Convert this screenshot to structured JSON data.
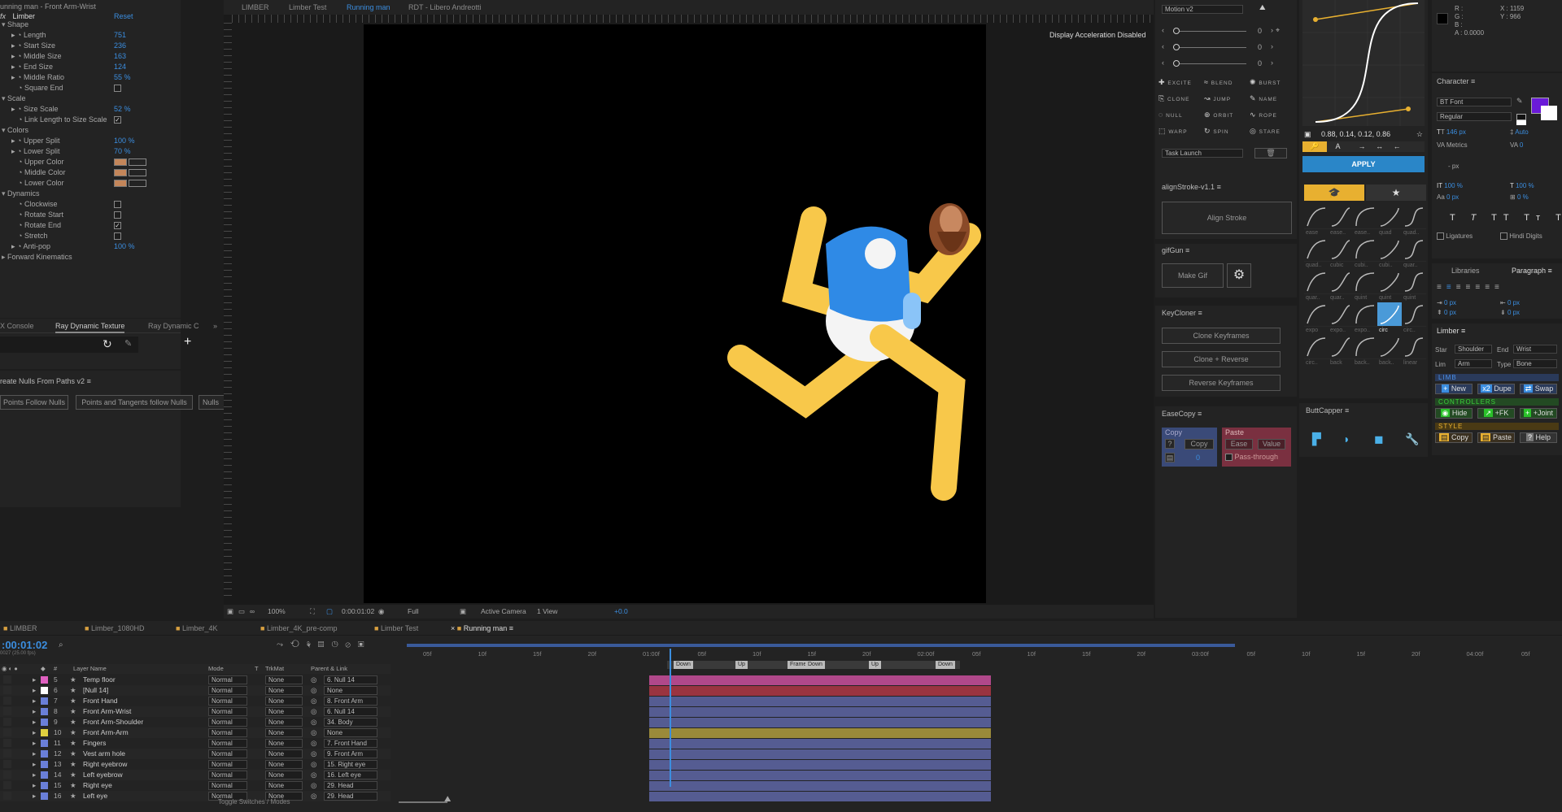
{
  "effects": {
    "title": "unning man - Front Arm-Wrist",
    "fx": "fx",
    "name": "Limber",
    "reset": "Reset",
    "rows": [
      {
        "t": "group",
        "label": "Shape"
      },
      {
        "t": "val",
        "label": "Length",
        "value": "751"
      },
      {
        "t": "val",
        "label": "Start Size",
        "value": "236"
      },
      {
        "t": "val",
        "label": "Middle Size",
        "value": "163"
      },
      {
        "t": "val",
        "label": "End Size",
        "value": "124"
      },
      {
        "t": "val",
        "label": "Middle Ratio",
        "value": "55 %"
      },
      {
        "t": "chk",
        "label": "Square End",
        "checked": false
      },
      {
        "t": "group",
        "label": "Scale"
      },
      {
        "t": "val",
        "label": "Size Scale",
        "value": "52 %"
      },
      {
        "t": "chk",
        "label": "Link Length to Size Scale",
        "checked": true
      },
      {
        "t": "group",
        "label": "Colors"
      },
      {
        "t": "val",
        "label": "Upper Split",
        "value": "100 %"
      },
      {
        "t": "val",
        "label": "Lower Split",
        "value": "70 %"
      },
      {
        "t": "col",
        "label": "Upper Color"
      },
      {
        "t": "col",
        "label": "Middle Color"
      },
      {
        "t": "col",
        "label": "Lower Color"
      },
      {
        "t": "group",
        "label": "Dynamics"
      },
      {
        "t": "chk",
        "label": "Clockwise",
        "checked": false
      },
      {
        "t": "chk",
        "label": "Rotate Start",
        "checked": false
      },
      {
        "t": "chk",
        "label": "Rotate End",
        "checked": true
      },
      {
        "t": "chk",
        "label": "Stretch",
        "checked": false
      },
      {
        "t": "val",
        "label": "Anti-pop",
        "value": "100 %"
      },
      {
        "t": "group2",
        "label": "Forward Kinematics"
      }
    ]
  },
  "console": {
    "tabs": [
      "X Console",
      "Ray Dynamic Texture",
      "Ray Dynamic C"
    ]
  },
  "nulls": {
    "title": "reate Nulls From Paths v2",
    "b1": "Points Follow Nulls",
    "b2": "Points and Tangents follow Nulls",
    "b3": "Nulls"
  },
  "comp": {
    "tabs": [
      "LIMBER",
      "Limber Test",
      "Running man",
      "RDT - Libero Andreotti"
    ],
    "notice": "Display Acceleration Disabled",
    "zoom": "100%",
    "time": "0:00:01:02",
    "res": "Full",
    "camera": "Active Camera",
    "view": "1 View",
    "exposure": "+0.0"
  },
  "motion": {
    "title": "Motion v2",
    "sliders": [
      "0",
      "0",
      "0"
    ],
    "actions": [
      "EXCITE",
      "BLEND",
      "BURST",
      "CLONE",
      "JUMP",
      "NAME",
      "NULL",
      "ORBIT",
      "ROPE",
      "WARP",
      "SPIN",
      "STARE"
    ],
    "task": "Task Launch"
  },
  "align": {
    "title": "alignStroke-v1.1",
    "btn": "Align Stroke"
  },
  "gifgun": {
    "title": "gifGun",
    "btn": "Make Gif"
  },
  "keycloner": {
    "title": "KeyCloner",
    "b1": "Clone Keyframes",
    "b2": "Clone + Reverse",
    "b3": "Reverse Keyframes"
  },
  "easecopy": {
    "title": "EaseCopy",
    "copy": "Copy",
    "copyBtn": "Copy",
    "zero": "0",
    "paste": "Paste",
    "ease": "Ease",
    "value": "Value",
    "pass": "Pass-through"
  },
  "flow": {
    "bezier": "0.88, 0.14, 0.12, 0.86",
    "apply": "APPLY",
    "labels": [
      "ease",
      "ease..",
      "ease..",
      "quad",
      "quad..",
      "quad..",
      "cubic",
      "cubi..",
      "cubi..",
      "quar..",
      "quar..",
      "quar..",
      "quint",
      "quint",
      "quint",
      "expo",
      "expo..",
      "expo..",
      "circ",
      "circ..",
      "circ..",
      "back",
      "back..",
      "back..",
      "linear"
    ]
  },
  "buttcapper": {
    "title": "ButtCapper"
  },
  "info": {
    "r": "R :",
    "g": "G :",
    "b": "B :",
    "a": "A : 0.0000",
    "x": "X : 1159",
    "y": "Y : 966"
  },
  "character": {
    "title": "Character",
    "font": "BT Font",
    "style": "Regular",
    "size": "146 px",
    "leading": "Auto",
    "kern": "Metrics",
    "track": "0",
    "unit": "- px",
    "vscale": "100 %",
    "hscale": "100 %",
    "baseline": "0 px",
    "tsume": "0 %",
    "lig": "Ligatures",
    "hindi": "Hindi Digits"
  },
  "paragraph": {
    "libs": "Libraries",
    "para": "Paragraph",
    "v1": "0 px",
    "v2": "0 px",
    "v3": "0 px",
    "v4": "0 px",
    "v5": "0 px"
  },
  "limber": {
    "title": "Limber",
    "star": "Star",
    "starVal": "Shoulder",
    "end": "End",
    "endVal": "Wrist",
    "lim": "Lim",
    "limVal": "Arm",
    "type": "Type",
    "typeVal": "Bone",
    "limb": "LIMB",
    "new": "New",
    "dupe": "Dupe",
    "swap": "Swap",
    "ctrl": "CONTROLLERS",
    "hide": "Hide",
    "fk": "+FK",
    "joint": "+Joint",
    "style": "STYLE",
    "copy": "Copy",
    "paste": "Paste",
    "help": "Help"
  },
  "timeline": {
    "tabs": [
      "LIMBER",
      "Limber_1080HD",
      "Limber_4K",
      "Limber_4K_pre-comp",
      "Limber Test",
      "Running man"
    ],
    "time": ":00:01:02",
    "sub": "0027 (25.00 fps)",
    "headers": {
      "num": "#",
      "name": "Layer Name",
      "mode": "Mode",
      "t": "T",
      "trk": "TrkMat",
      "parent": "Parent & Link"
    },
    "ruler": [
      "05f",
      "10f",
      "15f",
      "20f",
      "01:00f",
      "05f",
      "10f",
      "15f",
      "20f",
      "02:00f",
      "05f",
      "10f",
      "15f",
      "20f",
      "03:00f",
      "05f",
      "10f",
      "15f",
      "20f",
      "04:00f",
      "05f"
    ],
    "markers": [
      "Down",
      "Up",
      "Frame",
      "Down",
      "Up",
      "Down"
    ],
    "layers": [
      {
        "n": "5",
        "name": "Temp floor",
        "color": "#e060c0",
        "mode": "Normal",
        "trk": "None",
        "parent": "6. Null 14",
        "bar": "#b0488a"
      },
      {
        "n": "6",
        "name": "[Null 14]",
        "color": "#ffffff",
        "mode": "Normal",
        "trk": "None",
        "parent": "None",
        "bar": "#9a3440"
      },
      {
        "n": "7",
        "name": "Front Hand",
        "color": "#6a7fd8",
        "mode": "Normal",
        "trk": "None",
        "parent": "8. Front Arm",
        "bar": "#555c92"
      },
      {
        "n": "8",
        "name": "Front Arm-Wrist",
        "color": "#6a7fd8",
        "mode": "Normal",
        "trk": "None",
        "parent": "6. Null 14",
        "bar": "#555c92"
      },
      {
        "n": "9",
        "name": "Front Arm-Shoulder",
        "color": "#6a7fd8",
        "mode": "Normal",
        "trk": "None",
        "parent": "34. Body",
        "bar": "#555c92"
      },
      {
        "n": "10",
        "name": "Front Arm-Arm",
        "color": "#e0d040",
        "mode": "Normal",
        "trk": "None",
        "parent": "None",
        "bar": "#9a8a3a"
      },
      {
        "n": "11",
        "name": "Fingers",
        "color": "#6a7fd8",
        "mode": "Normal",
        "trk": "None",
        "parent": "7. Front Hand",
        "bar": "#555c92"
      },
      {
        "n": "12",
        "name": "Vest arm hole",
        "color": "#6a7fd8",
        "mode": "Normal",
        "trk": "None",
        "parent": "9. Front Arm",
        "bar": "#555c92"
      },
      {
        "n": "13",
        "name": "Right eyebrow",
        "color": "#6a7fd8",
        "mode": "Normal",
        "trk": "None",
        "parent": "15. Right eye",
        "bar": "#555c92"
      },
      {
        "n": "14",
        "name": "Left eyebrow",
        "color": "#6a7fd8",
        "mode": "Normal",
        "trk": "None",
        "parent": "16. Left eye",
        "bar": "#555c92"
      },
      {
        "n": "15",
        "name": "Right eye",
        "color": "#6a7fd8",
        "mode": "Normal",
        "trk": "None",
        "parent": "29. Head",
        "bar": "#555c92"
      },
      {
        "n": "16",
        "name": "Left eye",
        "color": "#6a7fd8",
        "mode": "Normal",
        "trk": "None",
        "parent": "29. Head",
        "bar": "#555c92"
      }
    ],
    "toggle": "Toggle Switches / Modes"
  }
}
